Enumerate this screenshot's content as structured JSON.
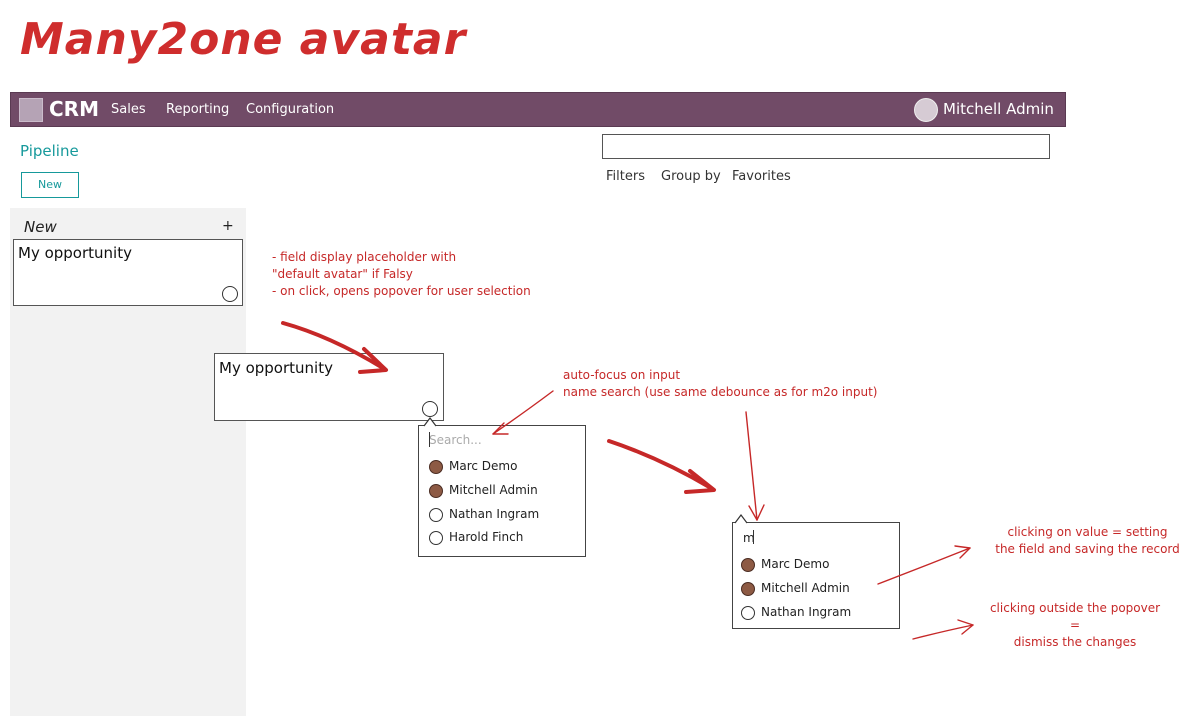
{
  "title": "Many2one avatar",
  "navbar": {
    "app_name": "CRM",
    "menu": [
      "Sales",
      "Reporting",
      "Configuration"
    ],
    "user_name": "Mitchell Admin"
  },
  "breadcrumb": "Pipeline",
  "new_button": "New",
  "search": {
    "filters_label": "Filters",
    "group_by_label": "Group by",
    "favorites_label": "Favorites"
  },
  "kanban": {
    "column_title": "New",
    "add_symbol": "+",
    "card_title": "My opportunity"
  },
  "zoom_card": {
    "title": "My opportunity"
  },
  "popover1": {
    "placeholder": "Search...",
    "users": [
      {
        "name": "Marc Demo",
        "has_avatar": true
      },
      {
        "name": "Mitchell Admin",
        "has_avatar": true
      },
      {
        "name": "Nathan Ingram",
        "has_avatar": false
      },
      {
        "name": "Harold Finch",
        "has_avatar": false
      }
    ]
  },
  "popover2": {
    "query": "m",
    "users": [
      {
        "name": "Marc Demo",
        "has_avatar": true
      },
      {
        "name": "Mitchell Admin",
        "has_avatar": true
      },
      {
        "name": "Nathan Ingram",
        "has_avatar": false
      }
    ]
  },
  "notes": {
    "field_display": [
      "- field display placeholder with",
      "\"default avatar\" if Falsy",
      "- on click, opens popover for user selection"
    ],
    "autofocus": [
      "auto-focus on input",
      "name search (use same debounce as for m2o input)"
    ],
    "click_value": [
      "clicking on value = setting",
      "the field and saving the record"
    ],
    "click_outside": [
      "clicking outside the popover",
      "=",
      "dismiss the changes"
    ]
  },
  "colors": {
    "navbar": "#714b67",
    "accent": "#16999b",
    "annotation": "#c62828"
  }
}
